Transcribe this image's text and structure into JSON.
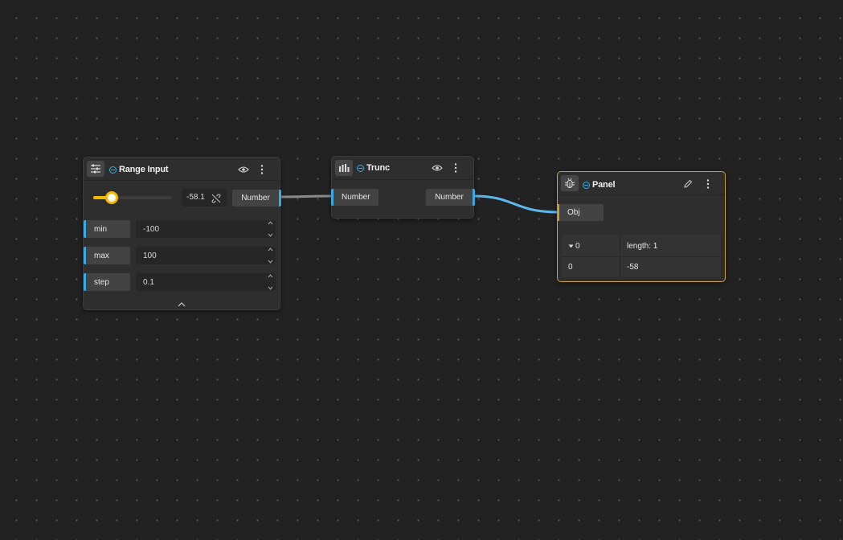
{
  "nodes": {
    "range_input": {
      "title": "Range Input",
      "value": "-58.1",
      "slider_fraction": 0.21,
      "output_label": "Number",
      "params": [
        {
          "label": "min",
          "value": "-100"
        },
        {
          "label": "max",
          "value": "100"
        },
        {
          "label": "step",
          "value": "0.1"
        }
      ]
    },
    "trunc": {
      "title": "Trunc",
      "input_label": "Number",
      "output_label": "Number"
    },
    "panel": {
      "title": "Panel",
      "input_label": "Obj",
      "tree_header": {
        "key": "0",
        "info": "length: 1"
      },
      "rows": [
        {
          "index": "0",
          "value": "-58"
        }
      ]
    }
  },
  "colors": {
    "background": "#222222",
    "node": "#2e2e2e",
    "wire_active": "#5cb8ea",
    "wire_default": "#8a8a8a",
    "port_accent": "#3aa8e4",
    "slider_accent": "#f5b800",
    "panel_border": "#c8a33c"
  },
  "icons": [
    "sliders-icon",
    "trunc-icon",
    "bug-icon",
    "eye-icon",
    "more-vertical-icon",
    "pencil-icon",
    "unlink-icon",
    "chevron-up-icon",
    "caret-down-icon"
  ]
}
